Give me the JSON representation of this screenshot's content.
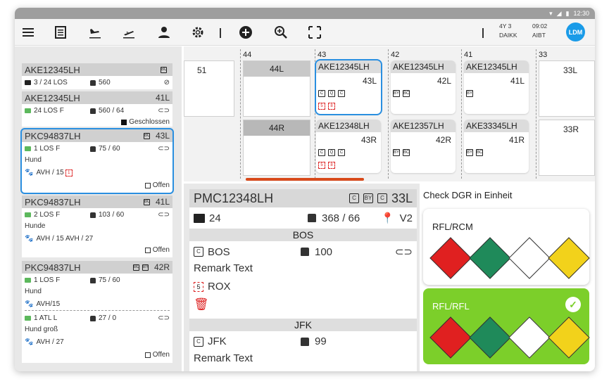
{
  "status_bar": {
    "time": "12:30"
  },
  "toolbar": {
    "flight_line1": "4Y 3",
    "flight_line2": "DAIKK",
    "time_line1": "09:02",
    "time_line2": "AIBT",
    "avatar": "LDM"
  },
  "left_list": [
    {
      "id": "AKE12345LH",
      "pos": "",
      "pieces": "3 / 24 LOS",
      "weight": "560",
      "status": ""
    },
    {
      "id": "AKE12345LH",
      "pos": "41L",
      "pieces": "24 LOS F",
      "weight": "560 / 64",
      "status": "Geschlossen"
    },
    {
      "id": "PKC94837LH",
      "pos": "43L",
      "pieces": "1 LOS F",
      "weight": "75 / 60",
      "desc": "Hund",
      "extra": "AVH / 15",
      "extra_badge": "1",
      "status": "Offen"
    },
    {
      "id": "PKC94837LH",
      "pos": "41L",
      "pieces": "2 LOS F",
      "weight": "103 / 60",
      "desc": "Hunde",
      "extra": "AVH / 15 AVH / 27",
      "status": "Offen"
    },
    {
      "id": "PKC94837LH",
      "pos": "42R",
      "pieces": "1 LOS F",
      "weight": "75 / 60",
      "desc": "Hund",
      "extra": "AVH/15",
      "pieces2": "1 ATL L",
      "weight2": "27 / 0",
      "desc2": "Hund groß",
      "extra2": "AVH / 27",
      "status": "Offen"
    }
  ],
  "grid": {
    "columns": [
      "44",
      "43",
      "42",
      "41",
      "33"
    ],
    "left_label": "51",
    "empty_slots": [
      "44L",
      "44R"
    ],
    "right_slots": [
      "33L",
      "33R"
    ],
    "ulds": [
      {
        "id": "AKE12345LH",
        "pos": "43L",
        "icons": [
          "C",
          "Q",
          "C"
        ],
        "dgr": [
          "5",
          "8"
        ],
        "selected": true
      },
      {
        "id": "AKE12345LH",
        "pos": "42L",
        "icons": [
          "BY",
          "BC"
        ]
      },
      {
        "id": "AKE12345LH",
        "pos": "41L",
        "icons": [
          "BY"
        ]
      },
      {
        "id": "AKE12348LH",
        "pos": "43R",
        "icons": [
          "C",
          "Q",
          "C"
        ],
        "dgr": [
          "5",
          "8"
        ]
      },
      {
        "id": "AKE12357LH",
        "pos": "42R",
        "icons": [
          "BY",
          "BC"
        ]
      },
      {
        "id": "AKE33345LH",
        "pos": "41R",
        "icons": [
          "BY",
          "BC"
        ]
      }
    ]
  },
  "detail": {
    "id": "PMC12348LH",
    "pos": "33L",
    "header_icons": [
      "C",
      "BY",
      "C"
    ],
    "pieces": "24",
    "weight": "368 / 66",
    "location": "V2",
    "sections": [
      {
        "station": "BOS",
        "code": "BOS",
        "weight": "100",
        "remark": "Remark Text",
        "dgr_code": "ROX",
        "dgr_class": "5"
      },
      {
        "station": "JFK",
        "code": "JFK",
        "weight": "99",
        "remark": "Remark Text"
      }
    ]
  },
  "dgr": {
    "title": "Check DGR in Einheit",
    "cards": [
      {
        "label": "RFL/RCM",
        "ok": false
      },
      {
        "label": "RFL/RFL",
        "ok": true
      }
    ],
    "placards": [
      {
        "name": "FLAMMABLE GAS",
        "color": "#e02020"
      },
      {
        "name": "NON FLAMMABLE GAS",
        "color": "#1f8a5a"
      },
      {
        "name": "TOXIC GAS",
        "color": "#ffffff"
      },
      {
        "name": "FLAMMABLE LIQUID",
        "color": "#f2d21b"
      }
    ],
    "ok_color": "#7ccf2a"
  }
}
